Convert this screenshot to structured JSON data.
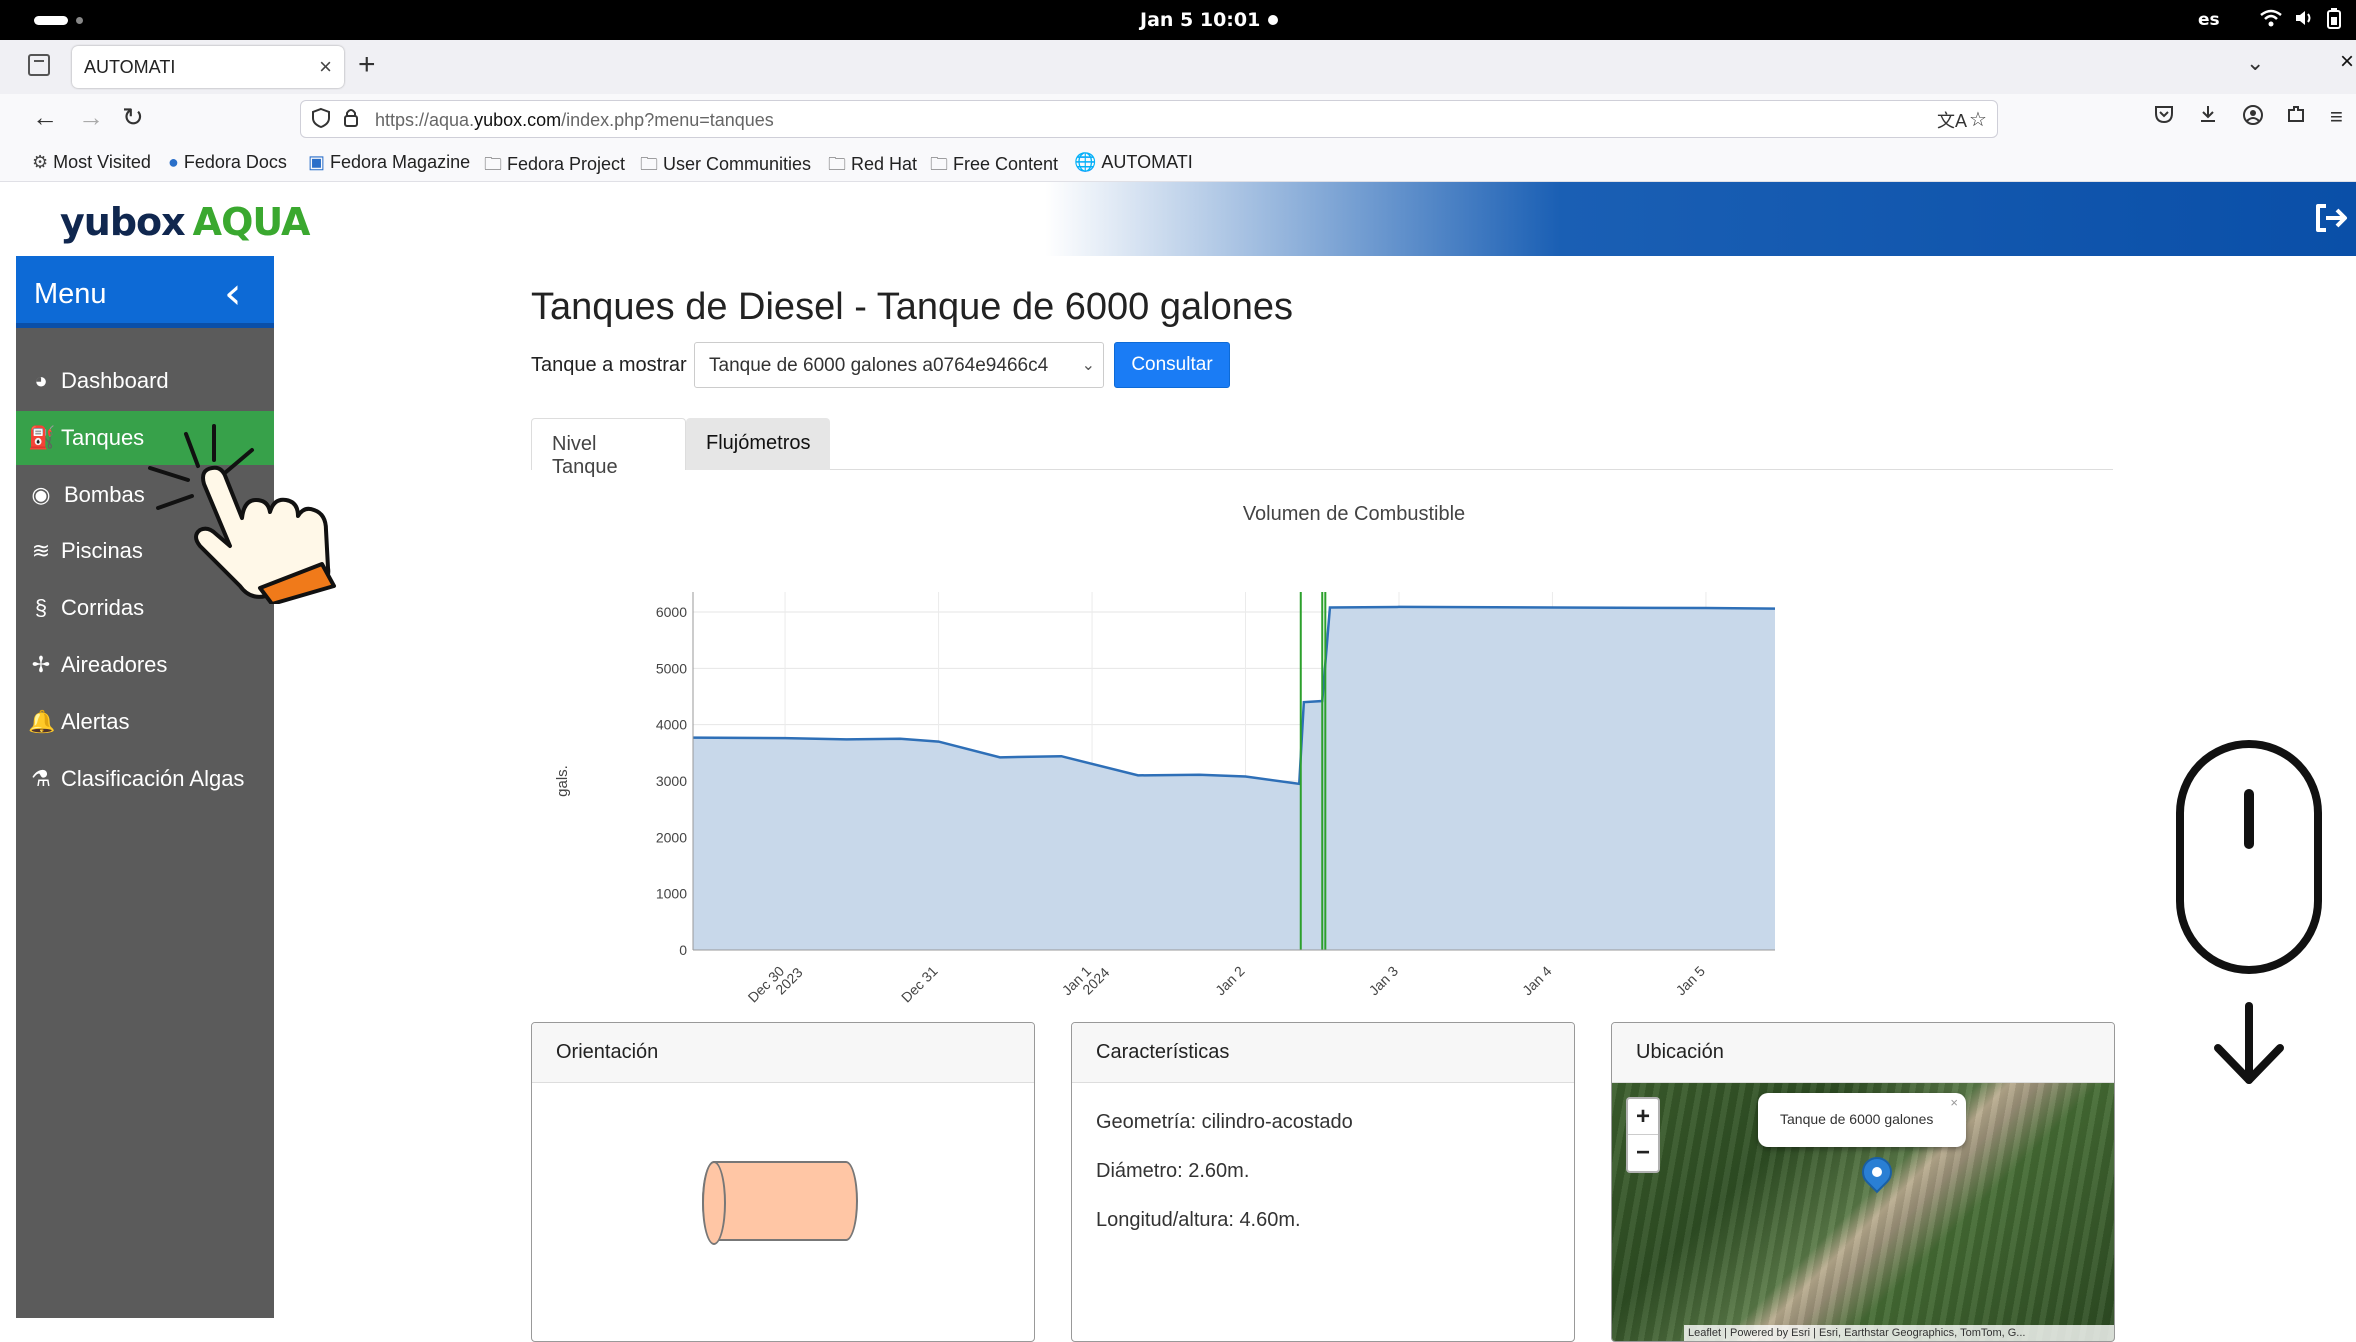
{
  "os": {
    "clock": "Jan 5  10:01",
    "lang": "es"
  },
  "browser": {
    "tab_title": "AUTOMATI",
    "url_prefix": "https://aqua.",
    "url_domain": "yubox.com",
    "url_path": "/index.php?menu=tanques",
    "bookmarks": [
      {
        "label": "Most Visited",
        "icon": "gear-icon"
      },
      {
        "label": "Fedora Docs",
        "icon": "fedora-icon"
      },
      {
        "label": "Fedora Magazine",
        "icon": "magazine-icon"
      },
      {
        "label": "Fedora Project",
        "icon": "folder-icon"
      },
      {
        "label": "User Communities",
        "icon": "folder-icon"
      },
      {
        "label": "Red Hat",
        "icon": "folder-icon"
      },
      {
        "label": "Free Content",
        "icon": "folder-icon"
      },
      {
        "label": "AUTOMATI",
        "icon": "globe-icon"
      }
    ]
  },
  "app": {
    "logo_main": "yubox",
    "logo_sub": "AQUA",
    "brand_blue": "#0d6ad6",
    "active_green": "#37a14a"
  },
  "sidebar": {
    "header": "Menu",
    "items": [
      {
        "label": "Dashboard",
        "icon": "gauge-icon",
        "active": false
      },
      {
        "label": "Tanques",
        "icon": "fuel-pump-icon",
        "active": true
      },
      {
        "label": "Bombas",
        "icon": "pump-icon",
        "active": false
      },
      {
        "label": "Piscinas",
        "icon": "water-waves-icon",
        "active": false
      },
      {
        "label": "Corridas",
        "icon": "shrimp-icon",
        "active": false
      },
      {
        "label": "Aireadores",
        "icon": "fan-icon",
        "active": false
      },
      {
        "label": "Alertas",
        "icon": "bell-icon",
        "active": false
      },
      {
        "label": "Clasificación Algas",
        "icon": "flask-icon",
        "active": false
      }
    ]
  },
  "main": {
    "title": "Tanques de Diesel - Tanque de 6000 galones",
    "select_label": "Tanque a mostrar",
    "select_value": "Tanque de 6000 galones a0764e9466c4",
    "consultar": "Consultar",
    "tabs": [
      "Nivel Tanque",
      "Flujómetros"
    ]
  },
  "chart_data": {
    "type": "area",
    "title": "Volumen de Combustible",
    "ylabel": "gals.",
    "xlabel": "",
    "ylim": [
      0,
      6000
    ],
    "yticks": [
      0,
      1000,
      2000,
      3000,
      4000,
      5000,
      6000
    ],
    "x_range_days": [
      -0.6,
      6.45
    ],
    "xticks": [
      {
        "day": 0,
        "label": [
          "Dec 30",
          "2023"
        ]
      },
      {
        "day": 1,
        "label": [
          "Dec 31"
        ]
      },
      {
        "day": 2,
        "label": [
          "Jan 1",
          "2024"
        ]
      },
      {
        "day": 3,
        "label": [
          "Jan 2"
        ]
      },
      {
        "day": 4,
        "label": [
          "Jan 3"
        ]
      },
      {
        "day": 5,
        "label": [
          "Jan 4"
        ]
      },
      {
        "day": 6,
        "label": [
          "Jan 5"
        ]
      }
    ],
    "series": [
      {
        "color": "#2e6fb7",
        "fill": "#c8d8ea",
        "points": [
          [
            -0.6,
            3770
          ],
          [
            0.0,
            3760
          ],
          [
            0.4,
            3740
          ],
          [
            0.75,
            3750
          ],
          [
            1.0,
            3700
          ],
          [
            1.4,
            3420
          ],
          [
            1.8,
            3440
          ],
          [
            2.3,
            3100
          ],
          [
            2.7,
            3110
          ],
          [
            3.0,
            3080
          ],
          [
            3.35,
            2950
          ],
          [
            3.38,
            4400
          ],
          [
            3.5,
            4420
          ],
          [
            3.55,
            6080
          ],
          [
            4.0,
            6090
          ],
          [
            5.0,
            6080
          ],
          [
            6.0,
            6070
          ],
          [
            6.45,
            6060
          ]
        ]
      }
    ],
    "markers": [
      {
        "day": 3.36,
        "color": "#2ca02c"
      },
      {
        "day": 3.5,
        "color": "#2ca02c"
      },
      {
        "day": 3.52,
        "color": "#2ca02c"
      }
    ]
  },
  "cards": {
    "orientacion": {
      "title": "Orientación"
    },
    "caracteristicas": {
      "title": "Características",
      "lines": [
        "Geometría: cilindro-acostado",
        "Diámetro: 2.60m.",
        "Longitud/altura: 4.60m."
      ]
    },
    "ubicacion": {
      "title": "Ubicación",
      "popup": "Tanque de 6000 galones",
      "attribution": "Leaflet | Powered by Esri | Esri, Earthstar Geographics, TomTom, G..."
    }
  }
}
